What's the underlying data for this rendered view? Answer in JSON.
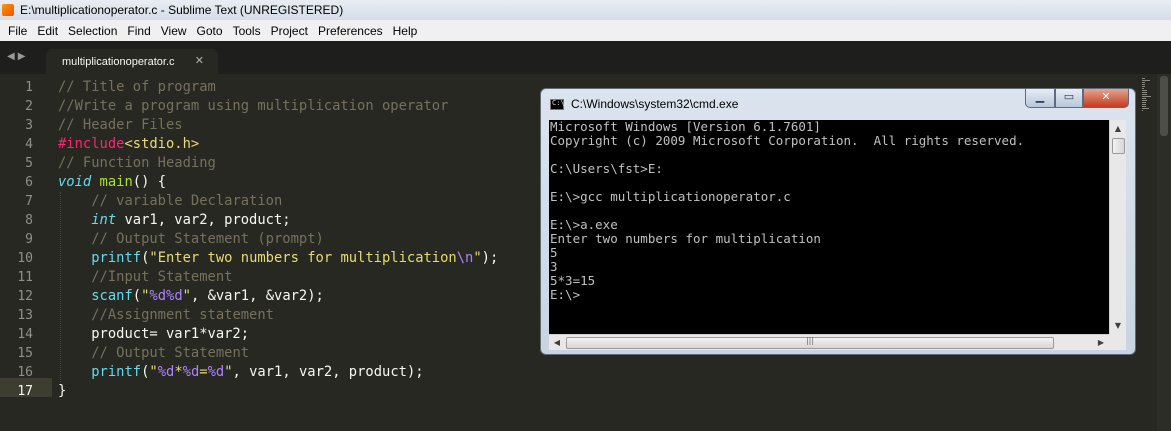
{
  "window": {
    "title": "E:\\multiplicationoperator.c - Sublime Text (UNREGISTERED)"
  },
  "menu": [
    "File",
    "Edit",
    "Selection",
    "Find",
    "View",
    "Goto",
    "Tools",
    "Project",
    "Preferences",
    "Help"
  ],
  "tabs": [
    {
      "label": "multiplicationoperator.c",
      "active": true
    }
  ],
  "editor": {
    "current_line": 17,
    "line_numbers": [
      "1",
      "2",
      "3",
      "4",
      "5",
      "6",
      "7",
      "8",
      "9",
      "10",
      "11",
      "12",
      "13",
      "14",
      "15",
      "16",
      "17"
    ],
    "code_lines": [
      [
        {
          "t": "// Title of program",
          "c": "comment"
        }
      ],
      [
        {
          "t": "//Write a program using multiplication operator",
          "c": "comment"
        }
      ],
      [
        {
          "t": "// Header Files",
          "c": "comment"
        }
      ],
      [
        {
          "t": "#include",
          "c": "keyword"
        },
        {
          "t": "<stdio.h>",
          "c": "string"
        }
      ],
      [
        {
          "t": "// Function Heading",
          "c": "comment"
        }
      ],
      [
        {
          "t": "void",
          "c": "type"
        },
        {
          "t": " ",
          "c": "plain"
        },
        {
          "t": "main",
          "c": "func"
        },
        {
          "t": "() {",
          "c": "plain"
        }
      ],
      [
        {
          "t": "    ",
          "c": "plain"
        },
        {
          "t": "// variable Declaration",
          "c": "comment"
        }
      ],
      [
        {
          "t": "    ",
          "c": "plain"
        },
        {
          "t": "int",
          "c": "type"
        },
        {
          "t": " var1, var2, product;",
          "c": "plain"
        }
      ],
      [
        {
          "t": "    ",
          "c": "plain"
        },
        {
          "t": "// Output Statement (prompt)",
          "c": "comment"
        }
      ],
      [
        {
          "t": "    ",
          "c": "plain"
        },
        {
          "t": "printf",
          "c": "builtin"
        },
        {
          "t": "(",
          "c": "plain"
        },
        {
          "t": "\"Enter two numbers for multiplication",
          "c": "string"
        },
        {
          "t": "\\n",
          "c": "escape"
        },
        {
          "t": "\"",
          "c": "string"
        },
        {
          "t": ");",
          "c": "plain"
        }
      ],
      [
        {
          "t": "    ",
          "c": "plain"
        },
        {
          "t": "//Input Statement",
          "c": "comment"
        }
      ],
      [
        {
          "t": "    ",
          "c": "plain"
        },
        {
          "t": "scanf",
          "c": "builtin"
        },
        {
          "t": "(",
          "c": "plain"
        },
        {
          "t": "\"",
          "c": "string"
        },
        {
          "t": "%d%d",
          "c": "escape"
        },
        {
          "t": "\"",
          "c": "string"
        },
        {
          "t": ", &var1, &var2);",
          "c": "plain"
        }
      ],
      [
        {
          "t": "    ",
          "c": "plain"
        },
        {
          "t": "//Assignment statement",
          "c": "comment"
        }
      ],
      [
        {
          "t": "    product= var1*var2;",
          "c": "plain"
        }
      ],
      [
        {
          "t": "    ",
          "c": "plain"
        },
        {
          "t": "// Output Statement",
          "c": "comment"
        }
      ],
      [
        {
          "t": "    ",
          "c": "plain"
        },
        {
          "t": "printf",
          "c": "builtin"
        },
        {
          "t": "(",
          "c": "plain"
        },
        {
          "t": "\"",
          "c": "string"
        },
        {
          "t": "%d",
          "c": "escape"
        },
        {
          "t": "*",
          "c": "string"
        },
        {
          "t": "%d",
          "c": "escape"
        },
        {
          "t": "=",
          "c": "string"
        },
        {
          "t": "%d",
          "c": "escape"
        },
        {
          "t": "\"",
          "c": "string"
        },
        {
          "t": ", var1, var2, product);",
          "c": "plain"
        }
      ],
      [
        {
          "t": "}",
          "c": "plain"
        }
      ]
    ]
  },
  "cmd": {
    "title": "C:\\Windows\\system32\\cmd.exe",
    "icon_text": "C:\\",
    "output_lines": [
      "Microsoft Windows [Version 6.1.7601]",
      "Copyright (c) 2009 Microsoft Corporation.  All rights reserved.",
      "",
      "C:\\Users\\fst>E:",
      "",
      "E:\\>gcc multiplicationoperator.c",
      "",
      "E:\\>a.exe",
      "Enter two numbers for multiplication",
      "5",
      "3",
      "5*3=15",
      "E:\\>"
    ]
  },
  "colors": {
    "editor_bg": "#272822",
    "comment": "#75715e",
    "keyword": "#f92672",
    "type": "#66d9ef",
    "func": "#a6e22e",
    "string": "#e6db74",
    "escape": "#ae81ff",
    "console_text": "#c0c0c0"
  }
}
